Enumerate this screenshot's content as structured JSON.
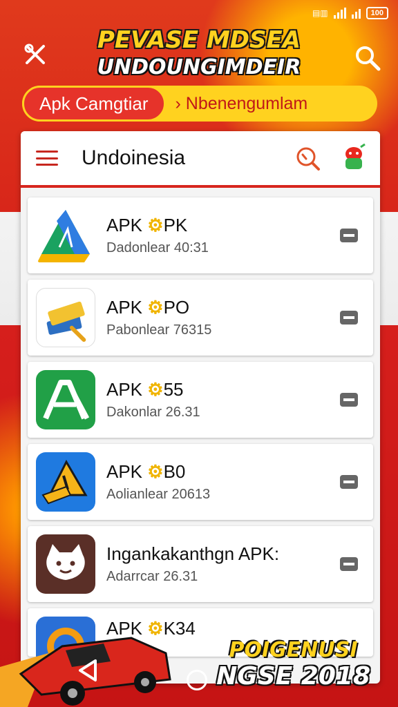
{
  "status": {
    "battery": "100"
  },
  "header": {
    "title_line1": "PEVASE MDSEA",
    "title_line2": "UNDOUNGIMDEIR"
  },
  "category_bar": {
    "left_label": "Aрk  Camgtiar",
    "right_label": "› Nbenengumlam"
  },
  "app_bar": {
    "title": "Undoinesia"
  },
  "apps": [
    {
      "name_prefix": "APK ",
      "name_mark": "⚙",
      "name_suffix": "PK",
      "subtitle": "Dadonlear  40:31",
      "icon": "triangle-drive-icon"
    },
    {
      "name_prefix": "APK ",
      "name_mark": "⚙",
      "name_suffix": "PO",
      "subtitle": "Pabonlear  76315",
      "icon": "books-brush-icon"
    },
    {
      "name_prefix": "APK ",
      "name_mark": "⚙",
      "name_suffix": "55",
      "subtitle": "Dakonlar  26.31",
      "icon": "letter-a-icon"
    },
    {
      "name_prefix": "APK ",
      "name_mark": "⚙",
      "name_suffix": "B0",
      "subtitle": "Aolianlear  20613",
      "icon": "paint-brush-icon"
    },
    {
      "name_prefix": "Ingankakanthgn APK:",
      "name_mark": "",
      "name_suffix": "",
      "subtitle": "Adarrcar  26.31",
      "icon": "cat-face-icon"
    },
    {
      "name_prefix": "APK ",
      "name_mark": "⚙",
      "name_suffix": "K34",
      "subtitle": "",
      "icon": "orange-ring-icon"
    }
  ],
  "promo": {
    "line1": "POIGENUSI",
    "line2": "NGSE 2018"
  },
  "colors": {
    "red": "#d7261e",
    "yellow": "#ffd21f",
    "gear": "#f0b400"
  }
}
